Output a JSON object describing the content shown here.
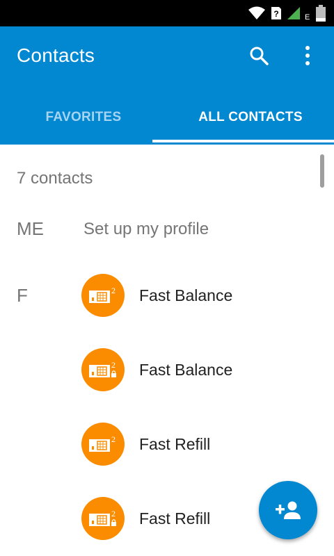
{
  "app": {
    "title": "Contacts"
  },
  "tabs": [
    {
      "label": "FAVORITES",
      "selected": false
    },
    {
      "label": "ALL CONTACTS",
      "selected": true
    }
  ],
  "list": {
    "count_label": "7 contacts",
    "me_header": "ME",
    "me_action": "Set up my profile",
    "section_f": "F",
    "contacts": [
      {
        "name": "Fast Balance",
        "avatar_icon": "sim-card-2-icon"
      },
      {
        "name": "Fast Balance",
        "avatar_icon": "sim-card-2-locked-icon"
      },
      {
        "name": "Fast Refill",
        "avatar_icon": "sim-card-2-icon"
      },
      {
        "name": "Fast Refill",
        "avatar_icon": "sim-card-2-locked-icon"
      }
    ]
  },
  "colors": {
    "primary": "#0288d1",
    "avatar": "#fb8c00",
    "tab_inactive": "#a6d4f2"
  },
  "icons": {
    "search": "search-icon",
    "more": "more-vert-icon",
    "fab": "add-contact-icon"
  }
}
